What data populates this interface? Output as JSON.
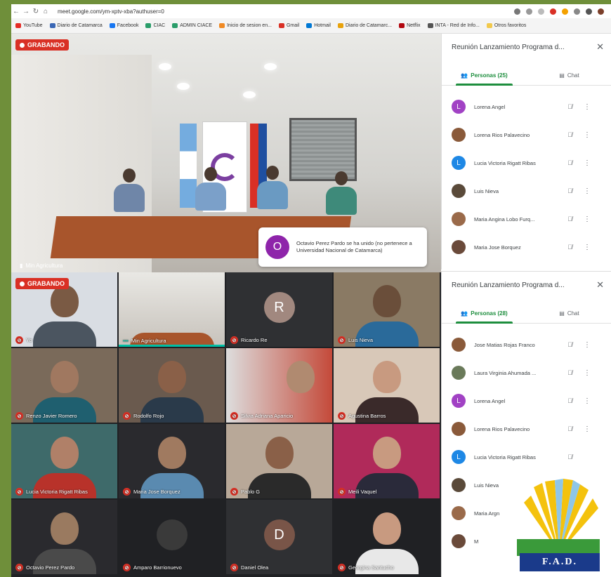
{
  "browser": {
    "url": "meet.google.com/ym-xptv-xba?authuser=0",
    "bookmarks": [
      "YouTube",
      "Diario de Catamarca",
      "Facebook",
      "CIAC",
      "ADMIN CIACE",
      "Inicio de sesion en...",
      "Gmail",
      "Hotmail",
      "Diario de Catamarc...",
      "Netflix",
      "INTA - Red de Info...",
      "Otros favoritos"
    ]
  },
  "main": {
    "recording_label": "GRABANDO",
    "speaker_name": "Min Agricultura",
    "toast": {
      "initial": "O",
      "message": "Octavio Perez Pardo se ha unido (no pertenece a Universidad Nacional de Catamarca)"
    }
  },
  "grid": {
    "recording_label": "GRABANDO",
    "tiles": [
      {
        "name": "Yo"
      },
      {
        "name": "Min Agricultura"
      },
      {
        "name": "Ricardo Re",
        "initial": "R"
      },
      {
        "name": "Luis Nieva"
      },
      {
        "name": "Renzo Javier Romero"
      },
      {
        "name": "Rodolfo Rojo"
      },
      {
        "name": "Silvia Adriana Aparicio"
      },
      {
        "name": "Agustina Barros"
      },
      {
        "name": "Lucia Victoria Rigatt Ribas"
      },
      {
        "name": "Maria Jose Borquez"
      },
      {
        "name": "Pablo G"
      },
      {
        "name": "Meili Vaquel"
      },
      {
        "name": "Octavio Perez Pardo"
      },
      {
        "name": "Amparo Barrionuevo"
      },
      {
        "name": "Daniel Olea",
        "initial": "D"
      },
      {
        "name": "Georgina Santucho"
      }
    ]
  },
  "panel1": {
    "title": "Reunión Lanzamiento Programa d...",
    "tab_people": "Personas (25)",
    "tab_chat": "Chat",
    "people": [
      {
        "name": "Lorena Angel",
        "initial": "L",
        "color": "#a142c4"
      },
      {
        "name": "Lorena Rios Palavecino",
        "initial": "",
        "color": "#8a5a3a"
      },
      {
        "name": "Lucia Victoria Rigatt Ribas",
        "initial": "L",
        "color": "#1e88e5"
      },
      {
        "name": "Luis Nieva",
        "initial": "",
        "color": "#5a4a3a"
      },
      {
        "name": "Maria Angina Lobo Furq...",
        "initial": "",
        "color": "#9a6a4a"
      },
      {
        "name": "Maria Jose Borquez",
        "initial": "",
        "color": "#6a4a3a"
      }
    ]
  },
  "panel2": {
    "title": "Reunión Lanzamiento Programa d...",
    "tab_people": "Personas (28)",
    "tab_chat": "Chat",
    "people": [
      {
        "name": "Jose Matias Rojas Franco",
        "initial": "",
        "color": "#8a5a3a"
      },
      {
        "name": "Laura Virginia Ahumada ...",
        "initial": "",
        "color": "#6a7a5a"
      },
      {
        "name": "Lorena Angel",
        "initial": "L",
        "color": "#a142c4"
      },
      {
        "name": "Lorena Rios Palavecino",
        "initial": "",
        "color": "#8a5a3a"
      },
      {
        "name": "Lucia Victoria Rigatt Ribas",
        "initial": "L",
        "color": "#1e88e5"
      },
      {
        "name": "Luis Nieva",
        "initial": "",
        "color": "#5a4a3a"
      },
      {
        "name": "Maria Argn",
        "initial": "",
        "color": "#9a6a4a"
      },
      {
        "name": "M",
        "initial": "",
        "color": "#6a4a3a"
      }
    ]
  },
  "logo": {
    "text": "F.A.D."
  }
}
